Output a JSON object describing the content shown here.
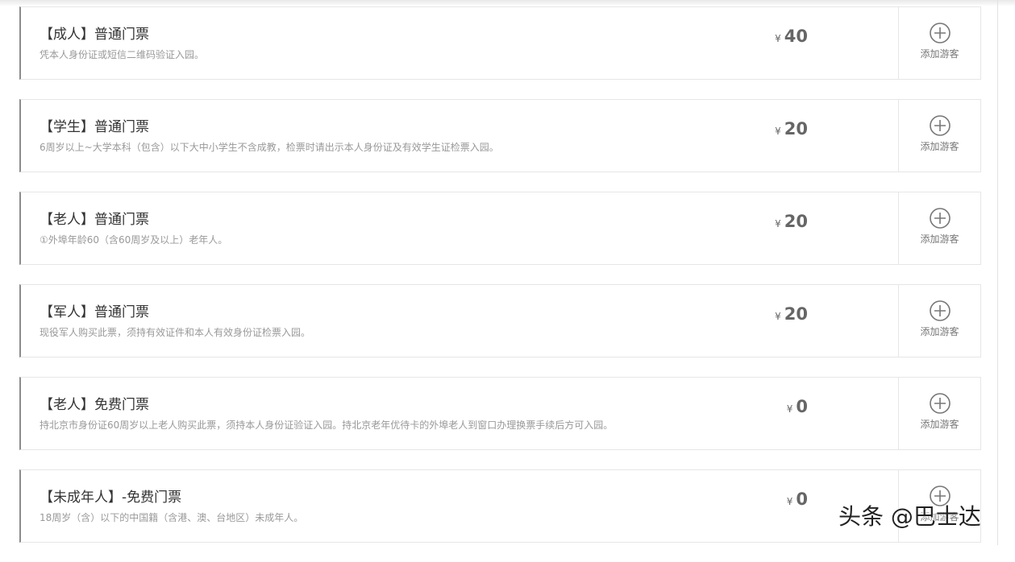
{
  "tickets": [
    {
      "name": "【成人】普通门票",
      "desc": "凭本人身份证或短信二维码验证入园。",
      "currency": "¥",
      "price": "40",
      "add_label": "添加游客"
    },
    {
      "name": "【学生】普通门票",
      "desc": "6周岁以上~大学本科（包含）以下大中小学生不含成教，检票时请出示本人身份证及有效学生证检票入园。",
      "currency": "¥",
      "price": "20",
      "add_label": "添加游客"
    },
    {
      "name": "【老人】普通门票",
      "desc": "①外埠年龄60（含60周岁及以上）老年人。",
      "currency": "¥",
      "price": "20",
      "add_label": "添加游客"
    },
    {
      "name": "【军人】普通门票",
      "desc": "现役军人购买此票，须持有效证件和本人有效身份证检票入园。",
      "currency": "¥",
      "price": "20",
      "add_label": "添加游客"
    },
    {
      "name": "【老人】免费门票",
      "desc": "持北京市身份证60周岁以上老人购买此票，须持本人身份证验证入园。持北京老年优待卡的外埠老人到窗口办理换票手续后方可入园。",
      "currency": "¥",
      "price": "0",
      "add_label": "添加游客"
    },
    {
      "name": "【未成年人】-免费门票",
      "desc": "18周岁（含）以下的中国籍（含港、澳、台地区）未成年人。",
      "currency": "¥",
      "price": "0",
      "add_label": "添加游客"
    }
  ],
  "icons": {
    "add": "plus-circle-icon"
  },
  "colors": {
    "border_accent": "#8c8c8c",
    "price": "#666666",
    "desc": "#999999"
  },
  "watermark": "头条 @巴士达"
}
